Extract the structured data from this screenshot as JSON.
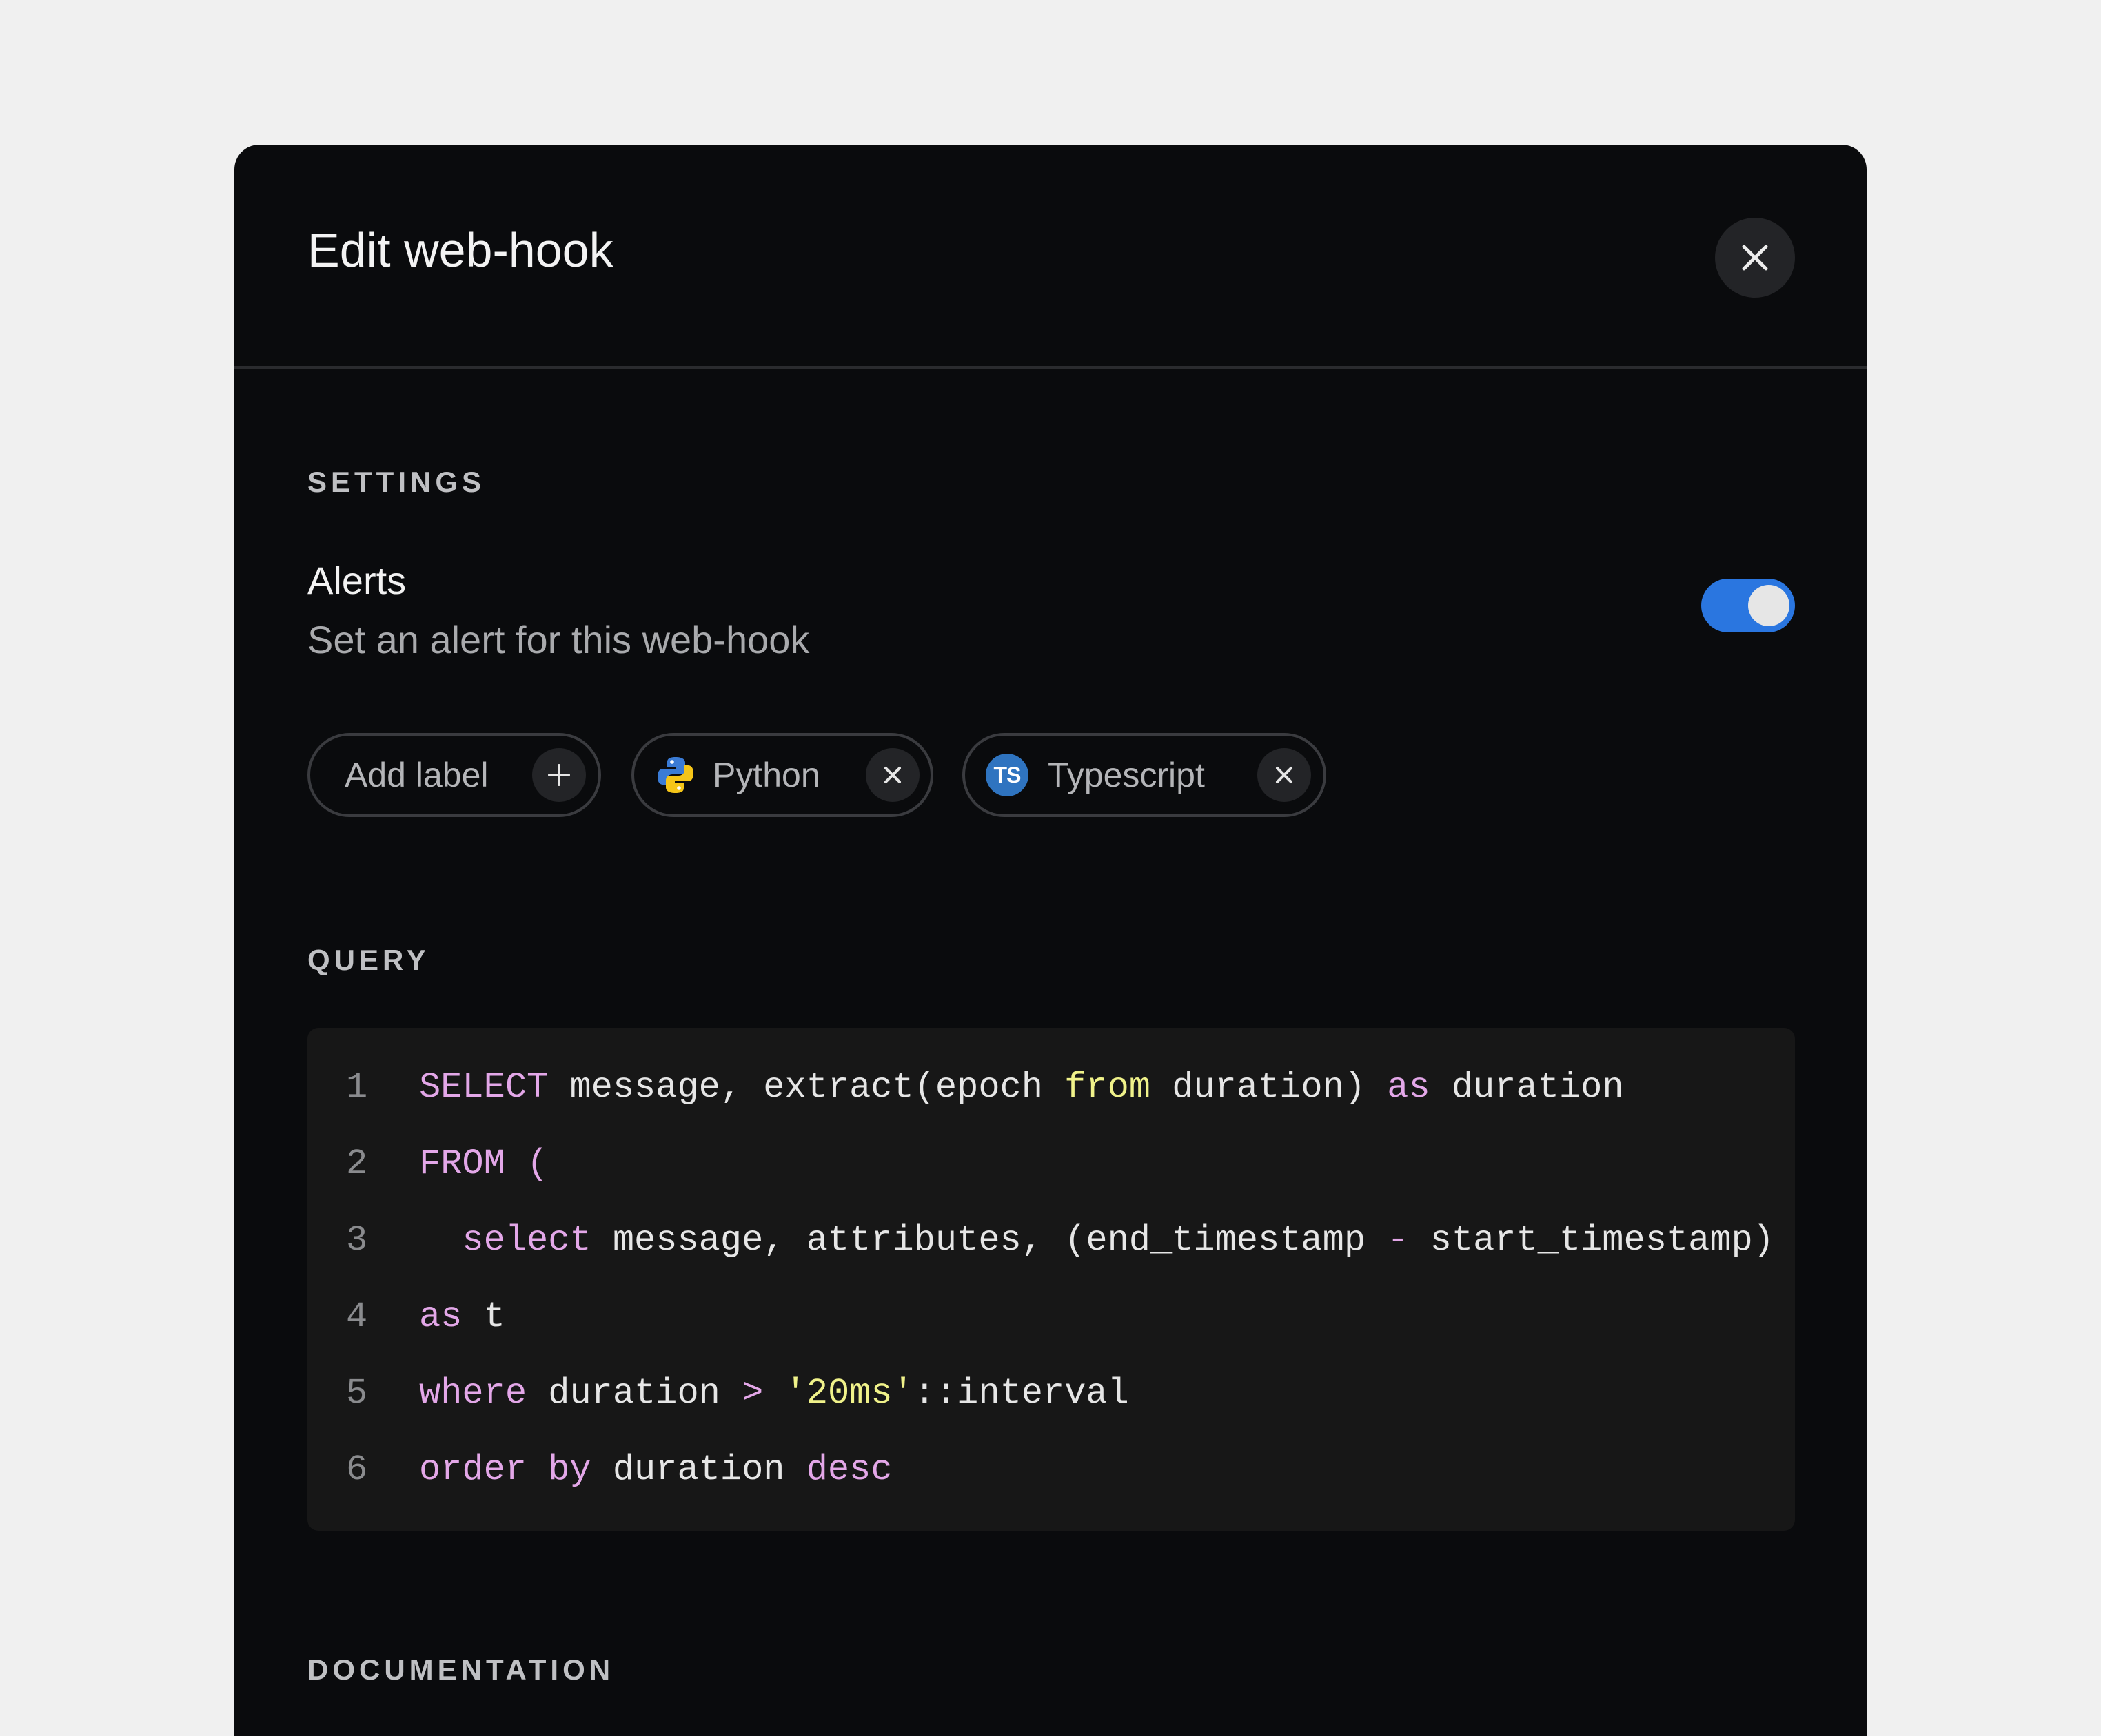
{
  "modal": {
    "title": "Edit web-hook",
    "close_icon": "close-icon"
  },
  "settings": {
    "section_label": "SETTINGS",
    "alerts_title": "Alerts",
    "alerts_description": "Set an alert for this web-hook",
    "alerts_enabled": true,
    "toggle_color": "#2a76e0"
  },
  "labels": {
    "add_label": "Add label",
    "chips": [
      {
        "name": "Python",
        "icon": "python-logo-icon"
      },
      {
        "name": "Typescript",
        "icon": "typescript-logo-icon",
        "badge": "TS"
      }
    ]
  },
  "query": {
    "section_label": "QUERY",
    "line_numbers": [
      "1",
      "2",
      "3",
      "4",
      "5",
      "6"
    ],
    "lines": [
      [
        {
          "t": "SELECT",
          "c": "kw"
        },
        {
          "t": " message, extract(epoch ",
          "c": ""
        },
        {
          "t": "from",
          "c": "kw2"
        },
        {
          "t": " duration) ",
          "c": ""
        },
        {
          "t": "as",
          "c": "kw"
        },
        {
          "t": " duration",
          "c": ""
        }
      ],
      [
        {
          "t": "FROM (",
          "c": "kw"
        }
      ],
      [
        {
          "t": "  select",
          "c": "kw"
        },
        {
          "t": " message, attributes, (end_timestamp ",
          "c": ""
        },
        {
          "t": "-",
          "c": "kw"
        },
        {
          "t": " start_timestamp)",
          "c": ""
        }
      ],
      [
        {
          "t": "as",
          "c": "kw"
        },
        {
          "t": " t",
          "c": ""
        }
      ],
      [
        {
          "t": "where",
          "c": "kw"
        },
        {
          "t": " duration ",
          "c": ""
        },
        {
          "t": ">",
          "c": "kw"
        },
        {
          "t": " ",
          "c": ""
        },
        {
          "t": "'20ms'",
          "c": "str"
        },
        {
          "t": "::interval",
          "c": ""
        }
      ],
      [
        {
          "t": "order by",
          "c": "kw"
        },
        {
          "t": " duration ",
          "c": ""
        },
        {
          "t": "desc",
          "c": "kw"
        }
      ]
    ]
  },
  "documentation": {
    "section_label": "DOCUMENTATION"
  }
}
